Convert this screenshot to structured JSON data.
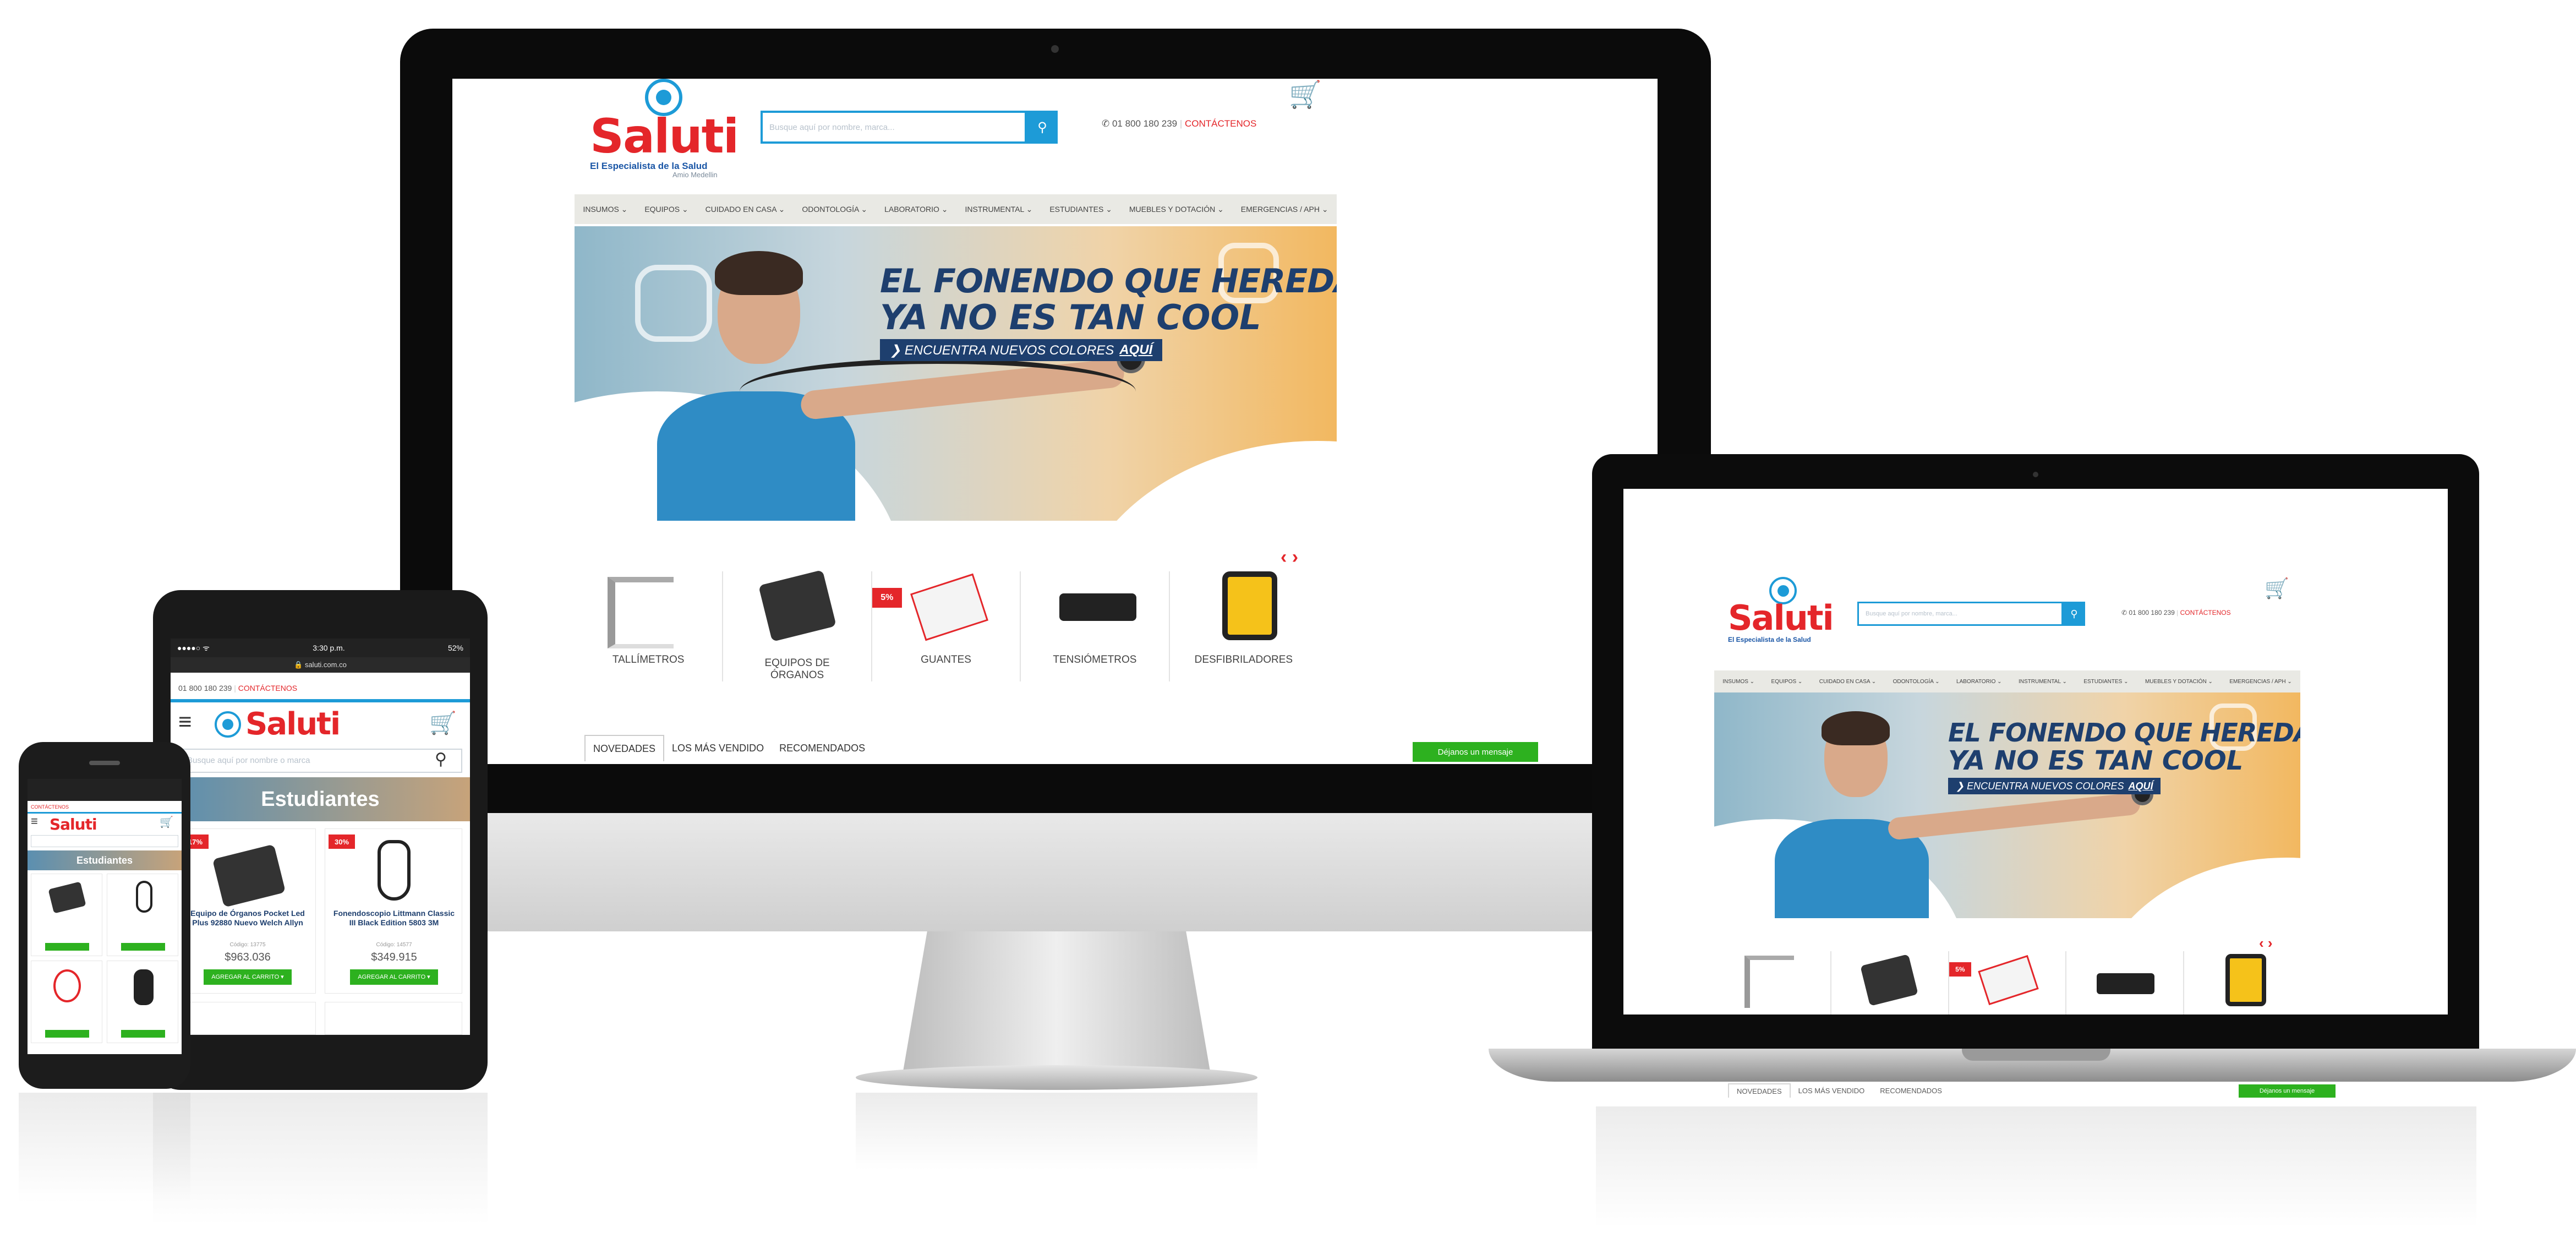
{
  "brand": {
    "name": "Saluti",
    "tagline": "El Especialista de la Salud",
    "sub": "Amio Medellin",
    "colors": {
      "red": "#e4262a",
      "blue": "#1d9bd7",
      "navy": "#1e3f6e",
      "green": "#2db11f"
    }
  },
  "header": {
    "search_placeholder": "Busque aquí por nombre, marca...",
    "search_icon": "search-icon",
    "phone": "✆ 01 800 180 239",
    "contact_label": "CONTÁCTENOS",
    "cart_icon": "cart-icon"
  },
  "nav": {
    "items": [
      "INSUMOS ⌄",
      "EQUIPOS ⌄",
      "CUIDADO EN CASA ⌄",
      "ODONTOLOGÍA ⌄",
      "LABORATORIO ⌄",
      "INSTRUMENTAL ⌄",
      "ESTUDIANTES ⌄",
      "MUEBLES Y DOTACIÓN ⌄",
      "EMERGENCIAS / APH ⌄"
    ]
  },
  "banner": {
    "line1": "EL FONENDO QUE HEREDASTE",
    "line2": "YA NO ES TAN COOL",
    "cta_prefix": "❯ ENCUENTRA NUEVOS COLORES",
    "cta_emphasis": "AQUÍ"
  },
  "categories": {
    "arrows": "‹ ›",
    "items": [
      {
        "label": "TALLÍMETROS",
        "badge": ""
      },
      {
        "label": "EQUIPOS DE ÓRGANOS",
        "badge": ""
      },
      {
        "label": "GUANTES",
        "badge": "5%"
      },
      {
        "label": "TENSIÓMETROS",
        "badge": ""
      },
      {
        "label": "DESFIBRILADORES",
        "badge": ""
      }
    ]
  },
  "tabs": {
    "items": [
      "NOVEDADES",
      "LOS MÁS VENDIDO",
      "RECOMENDADOS"
    ],
    "active_index": 0
  },
  "chat": {
    "label": "Déjanos un mensaje"
  },
  "tablet": {
    "status": {
      "carrier": "●●●●○ ᯤ",
      "time": "3:30 p.m.",
      "battery": "52%"
    },
    "url": "🔒 saluti.com.co",
    "phone": "01 800 180 239",
    "contact_label": "CONTÁCTENOS",
    "menu_icon": "hamburger-icon",
    "search_placeholder": "Busque aquí por nombre o marca",
    "hero": "Estudiantes",
    "products": [
      {
        "badge": "17%",
        "name": "Equipo de Órganos Pocket Led Plus 92880 Nuevo Welch Allyn",
        "code": "Código: 13775",
        "price": "$963.036",
        "button": "AGREGAR AL CARRITO ▾"
      },
      {
        "badge": "30%",
        "name": "Fonendoscopio Littmann Classic III Black Edition 5803 3M",
        "code": "Código: 14577",
        "price": "$349.915",
        "button": "AGREGAR AL CARRITO ▾"
      }
    ]
  },
  "phone_device": {
    "hero": "Estudiantes",
    "contact_label": "CONTÁCTENOS"
  }
}
